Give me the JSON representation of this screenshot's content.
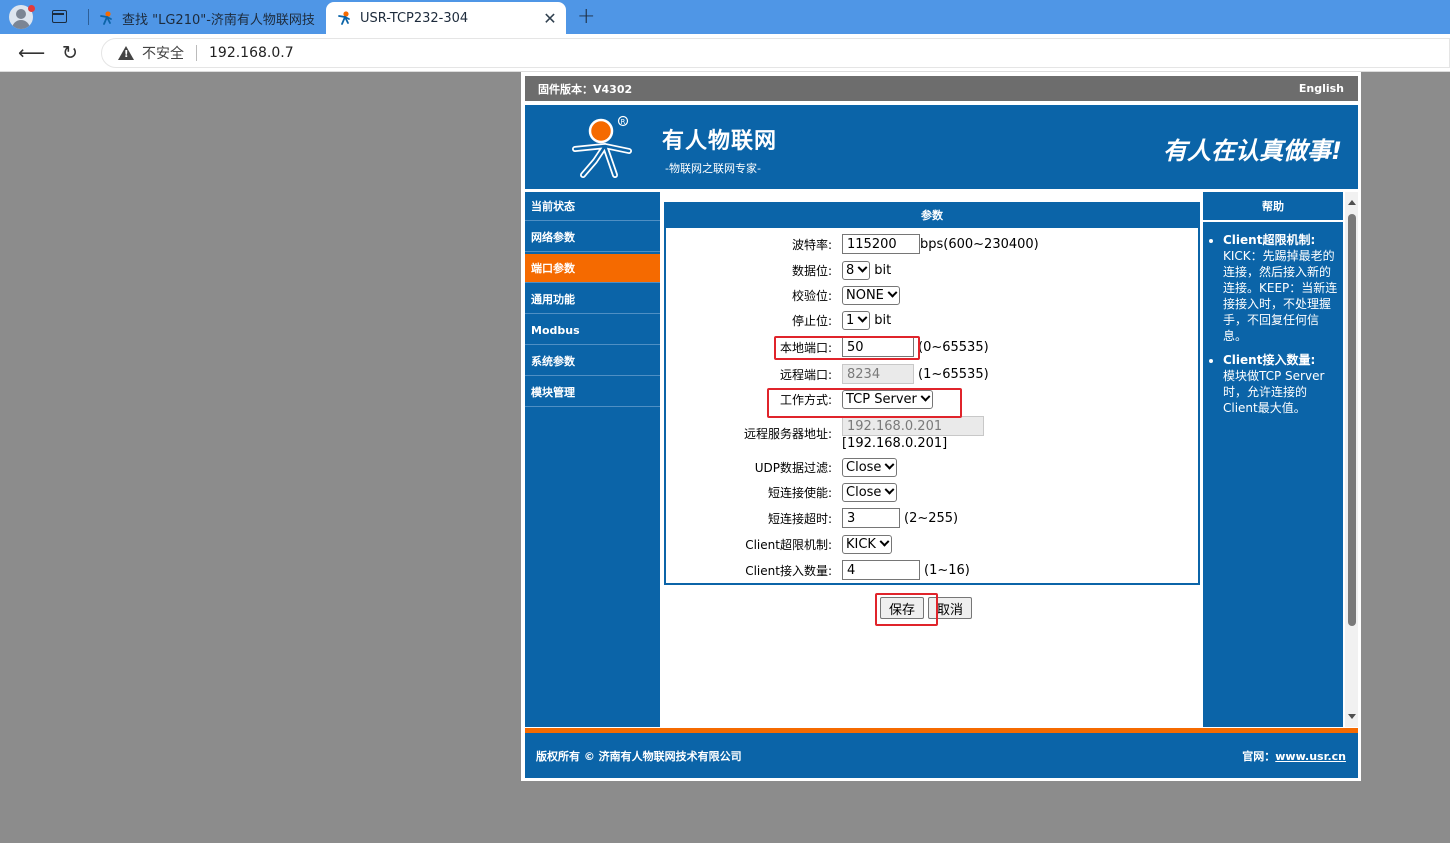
{
  "browser": {
    "tabs": [
      {
        "label": "查找 \"LG210\"-济南有人物联网技"
      },
      {
        "label": "USR-TCP232-304"
      }
    ],
    "close_glyph": "✕",
    "new_tab_glyph": "+",
    "security_label": "不安全",
    "url": "192.168.0.7"
  },
  "device": {
    "firmware": "固件版本：V4302",
    "language": "English",
    "brand": "有人物联网",
    "brand_sub": "-物联网之联网专家-",
    "slogan": "有人在认真做事!",
    "sidebar": [
      {
        "label": "当前状态",
        "active": false
      },
      {
        "label": "网络参数",
        "active": false
      },
      {
        "label": "端口参数",
        "active": true
      },
      {
        "label": "通用功能",
        "active": false
      },
      {
        "label": "Modbus",
        "active": false
      },
      {
        "label": "系统参数",
        "active": false
      },
      {
        "label": "模块管理",
        "active": false
      }
    ],
    "panel_title": "参数",
    "form": {
      "baud": {
        "label": "波特率:",
        "value": "115200",
        "hint": "bps(600~230400)"
      },
      "databits": {
        "label": "数据位:",
        "value": "8",
        "unit": "bit"
      },
      "parity": {
        "label": "校验位:",
        "value": "NONE"
      },
      "stopbits": {
        "label": "停止位:",
        "value": "1",
        "unit": "bit"
      },
      "local_port": {
        "label": "本地端口:",
        "value": "50",
        "hint": "(0~65535)"
      },
      "remote_port": {
        "label": "远程端口:",
        "value": "8234",
        "hint": "(1~65535)"
      },
      "work_mode": {
        "label": "工作方式:",
        "value": "TCP Server"
      },
      "remote_server": {
        "label": "远程服务器地址:",
        "value": "192.168.0.201",
        "note": "[192.168.0.201]"
      },
      "udp_filter": {
        "label": "UDP数据过滤:",
        "value": "Close"
      },
      "short_conn": {
        "label": "短连接使能:",
        "value": "Close"
      },
      "short_timeout": {
        "label": "短连接超时:",
        "value": "3",
        "hint": "(2~255)"
      },
      "client_limit": {
        "label": "Client超限机制:",
        "value": "KICK"
      },
      "client_count": {
        "label": "Client接入数量:",
        "value": "4",
        "hint": "(1~16)"
      }
    },
    "save_label": "保存",
    "cancel_label": "取消",
    "help": {
      "title": "帮助",
      "items": [
        {
          "title": "Client超限机制:",
          "text": "KICK：先踢掉最老的连接，然后接入新的连接。KEEP：当新连接接入时，不处理握手，不回复任何信息。"
        },
        {
          "title": "Client接入数量:",
          "text": "模块做TCP Server时，允许连接的Client最大值。"
        }
      ]
    },
    "footer": {
      "copyright": "版权所有 © 济南有人物联网技术有限公司",
      "site_label": "官网：",
      "site_url": "www.usr.cn"
    },
    "colors": {
      "primary": "#0b64a8",
      "accent": "#f56a00",
      "highlight": "#e0242b"
    }
  }
}
